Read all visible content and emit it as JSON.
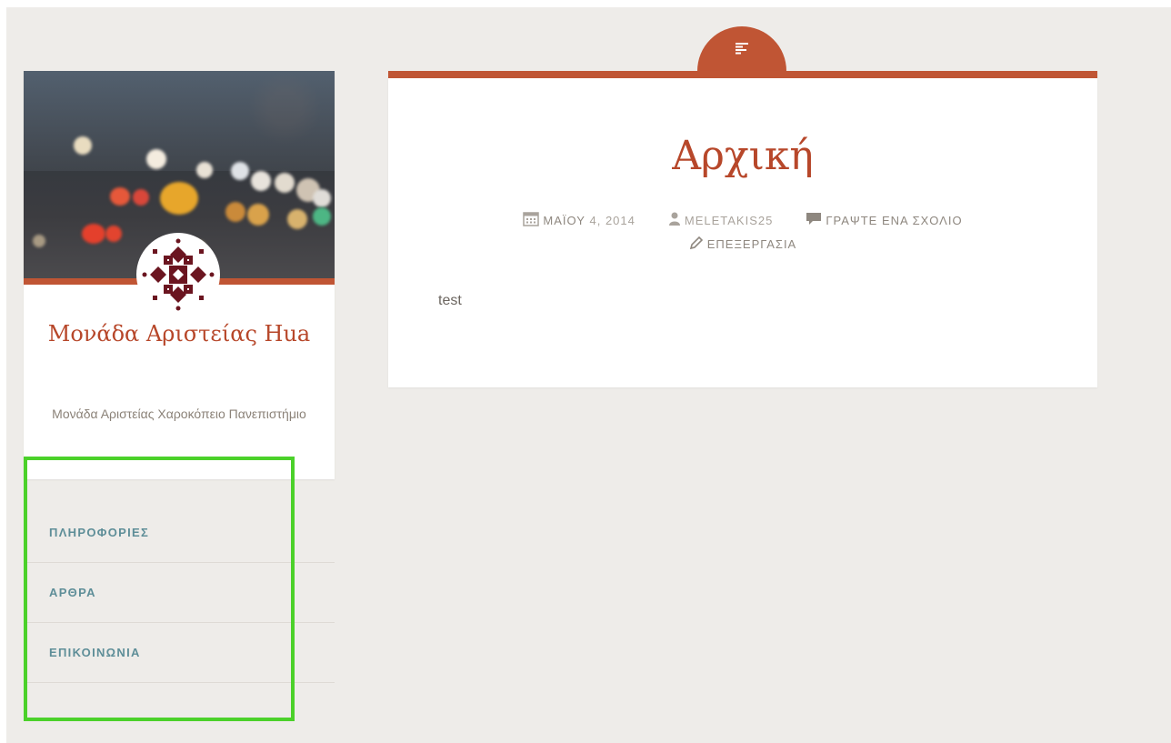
{
  "site": {
    "title": "Μονάδα Αριστείας Hua",
    "description": "Μονάδα Αριστείας Χαροκόπειο Πανεπιστήμιο"
  },
  "nav": {
    "items": [
      {
        "label": "ΠΛΗΡΟΦΟΡΙΕΣ"
      },
      {
        "label": "ΑΡΘΡΑ"
      },
      {
        "label": "ΕΠΙΚΟΙΝΩΝΙΑ"
      }
    ]
  },
  "post": {
    "format_icon": "standard-post-format-icon",
    "title": "Αρχική",
    "date_month": "ΜΑΪΟΥ",
    "date_rest": "4, 2014",
    "author": "MELETAKIS25",
    "comment_link": "ΓΡΑΨΤΕ ΕΝΑ ΣΧΟΛΙΟ",
    "edit_link": "ΕΠΕΞΕΡΓΑΣΙΑ",
    "body": "test"
  },
  "colors": {
    "accent": "#c05534",
    "title": "#b7472a",
    "nav_link": "#5e8e98",
    "background": "#eeece9",
    "highlight": "#4bd12a"
  }
}
